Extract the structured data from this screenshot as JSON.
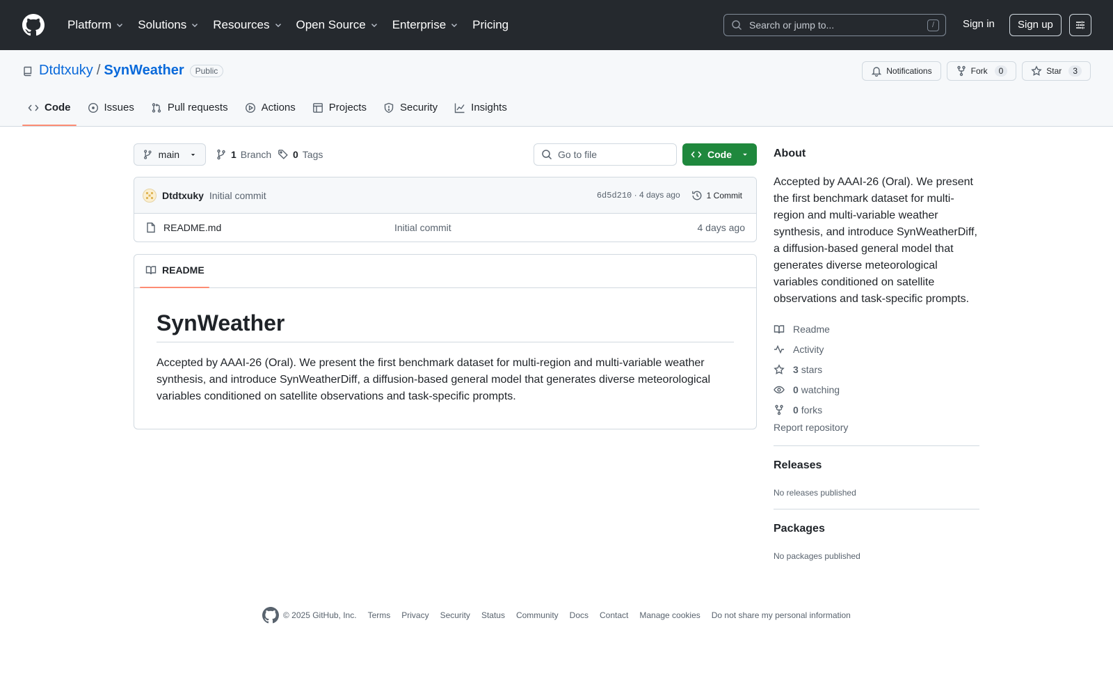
{
  "header": {
    "nav": [
      "Platform",
      "Solutions",
      "Resources",
      "Open Source",
      "Enterprise",
      "Pricing"
    ],
    "search_placeholder": "Search or jump to...",
    "search_shortcut": "/",
    "signin": "Sign in",
    "signup": "Sign up"
  },
  "repo": {
    "owner": "Dtdtxuky",
    "separator": "/",
    "name": "SynWeather",
    "visibility": "Public",
    "notifications": "Notifications",
    "fork_label": "Fork",
    "fork_count": "0",
    "star_label": "Star",
    "star_count": "3"
  },
  "tabs": [
    "Code",
    "Issues",
    "Pull requests",
    "Actions",
    "Projects",
    "Security",
    "Insights"
  ],
  "toolbar": {
    "branch": "main",
    "branch_count": "1",
    "branch_label": "Branch",
    "tag_count": "0",
    "tag_label": "Tags",
    "goto_placeholder": "Go to file",
    "code_button": "Code"
  },
  "commit": {
    "author": "Dtdtxuky",
    "message": "Initial commit",
    "hash": "6d5d210",
    "separator": " · ",
    "ago": "4 days ago",
    "count_label": "1 Commit"
  },
  "files": [
    {
      "name": "README.md",
      "commit": "Initial commit",
      "date": "4 days ago"
    }
  ],
  "readme": {
    "tab": "README",
    "title": "SynWeather",
    "body": "Accepted by AAAI-26 (Oral). We present the first benchmark dataset for multi-region and multi-variable weather synthesis, and introduce SynWeatherDiff, a diffusion-based general model that generates diverse meteorological variables conditioned on satellite observations and task-specific prompts."
  },
  "about": {
    "title": "About",
    "description": "Accepted by AAAI-26 (Oral). We present the first benchmark dataset for multi-region and multi-variable weather synthesis, and introduce SynWeatherDiff, a diffusion-based general model that generates diverse meteorological variables conditioned on satellite observations and task-specific prompts.",
    "readme": "Readme",
    "activity": "Activity",
    "stars_count": "3",
    "stars_label": "stars",
    "watching_count": "0",
    "watching_label": "watching",
    "forks_count": "0",
    "forks_label": "forks",
    "report": "Report repository"
  },
  "releases": {
    "title": "Releases",
    "empty": "No releases published"
  },
  "packages": {
    "title": "Packages",
    "empty": "No packages published"
  },
  "footer": {
    "copyright": "© 2025 GitHub, Inc.",
    "links": [
      "Terms",
      "Privacy",
      "Security",
      "Status",
      "Community",
      "Docs",
      "Contact",
      "Manage cookies",
      "Do not share my personal information"
    ]
  },
  "colors": {
    "header_bg": "#25292e",
    "link": "#0969da",
    "primary_button": "#1f883d",
    "tab_underline": "#fd8c73"
  }
}
